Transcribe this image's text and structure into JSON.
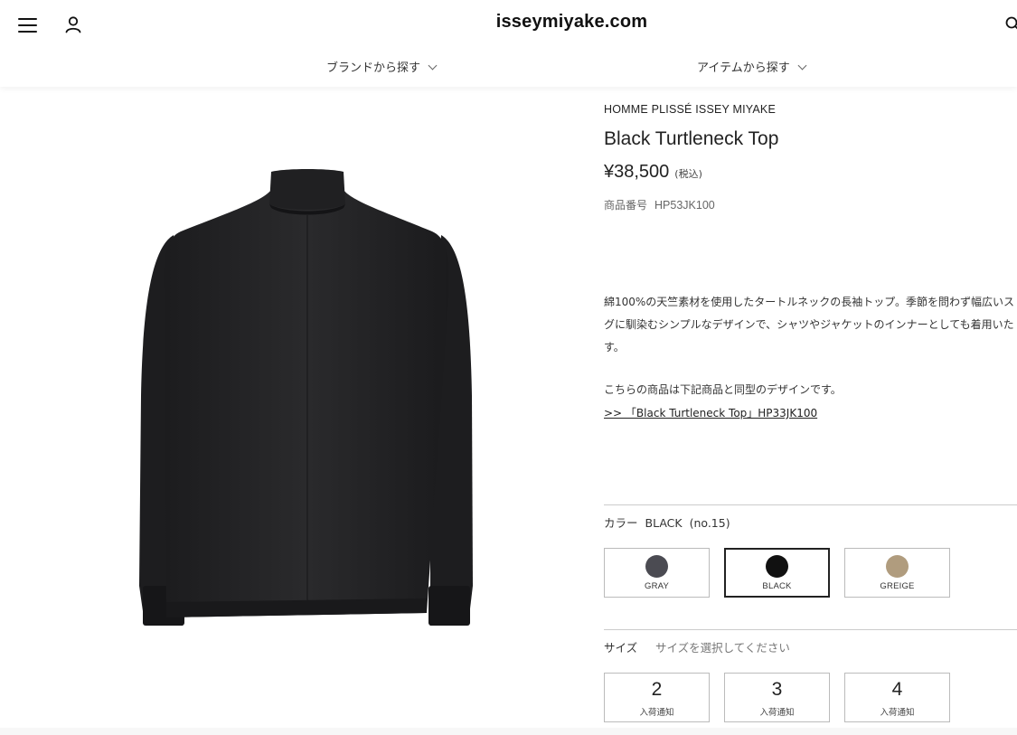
{
  "header": {
    "site_title": "isseymiyake.com",
    "nav": [
      {
        "label": "ブランドから探す"
      },
      {
        "label": "アイテムから探す"
      }
    ]
  },
  "product": {
    "brand": "HOMME PLISSÉ ISSEY MIYAKE",
    "name": "Black Turtleneck Top",
    "price": "¥38,500",
    "tax_note": "(税込)",
    "number_label": "商品番号",
    "number": "HP53JK100",
    "description_lines": [
      "綿100%の天竺素材を使用したタートルネックの長袖トップ。季節を問わず幅広いス",
      "グに馴染むシンプルなデザインで、シャツやジャケットのインナーとしても着用いた",
      "す。"
    ],
    "note": "こちらの商品は下記商品と同型のデザインです。",
    "related_link": ">> 「Black Turtleneck Top」HP33JK100"
  },
  "color": {
    "label": "カラー",
    "selected_name": "BLACK",
    "selected_no": "(no.15)",
    "options": [
      {
        "label": "GRAY",
        "hex": "#4b4b52",
        "selected": false
      },
      {
        "label": "BLACK",
        "hex": "#111111",
        "selected": true
      },
      {
        "label": "GREIGE",
        "hex": "#b09c7e",
        "selected": false
      }
    ]
  },
  "size": {
    "label": "サイズ",
    "hint": "サイズを選択してください",
    "options": [
      {
        "size": "2",
        "status": "入荷通知"
      },
      {
        "size": "3",
        "status": "入荷通知"
      },
      {
        "size": "4",
        "status": "入荷通知"
      }
    ]
  },
  "icons": {
    "menu": "hamburger-icon",
    "account": "user-icon",
    "search": "search-icon",
    "nav_chevron": "chevron-down-icon"
  }
}
